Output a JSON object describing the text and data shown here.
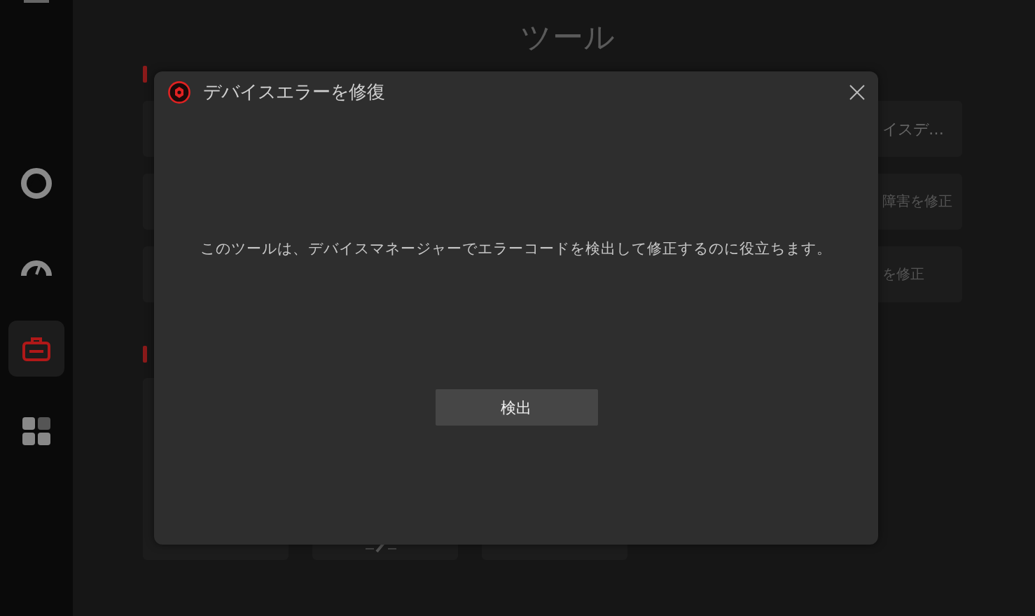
{
  "sidebar": {
    "items": [
      {
        "kind": "hamburger",
        "selected": false
      },
      {
        "kind": "ring",
        "selected": false
      },
      {
        "kind": "gauge",
        "selected": false
      },
      {
        "kind": "toolbox",
        "selected": true
      },
      {
        "kind": "grid",
        "selected": false
      }
    ]
  },
  "page_title": "ツール",
  "sections": [
    {
      "cards": [
        {
          "label": "イスデ…"
        },
        {
          "label": "障害を修正"
        },
        {
          "label": "を修正"
        }
      ]
    },
    {
      "cards": [
        {
          "kind": "plain"
        },
        {
          "kind": "pencil"
        },
        {
          "kind": "plain"
        }
      ]
    }
  ],
  "dialog": {
    "title": "デバイスエラーを修復",
    "message": "このツールは、デバイスマネージャーでエラーコードを検出して修正するのに役立ちます。",
    "button": "検出"
  }
}
